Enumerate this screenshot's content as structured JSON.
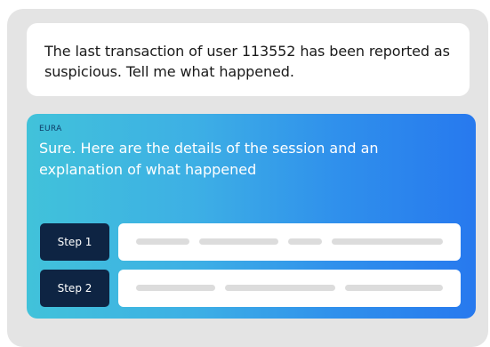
{
  "user_message": {
    "text": "The last transaction of user 113552 has been reported as suspicious. Tell me what happened."
  },
  "assistant_message": {
    "label": "EURA",
    "text": "Sure. Here are the details of the session and an explanation of what happened"
  },
  "steps": [
    {
      "label": "Step 1"
    },
    {
      "label": "Step 2"
    }
  ],
  "colors": {
    "background": "#e4e4e4",
    "step_button": "#0e2443",
    "gradient_start": "#41c2da",
    "gradient_end": "#2779ee"
  }
}
